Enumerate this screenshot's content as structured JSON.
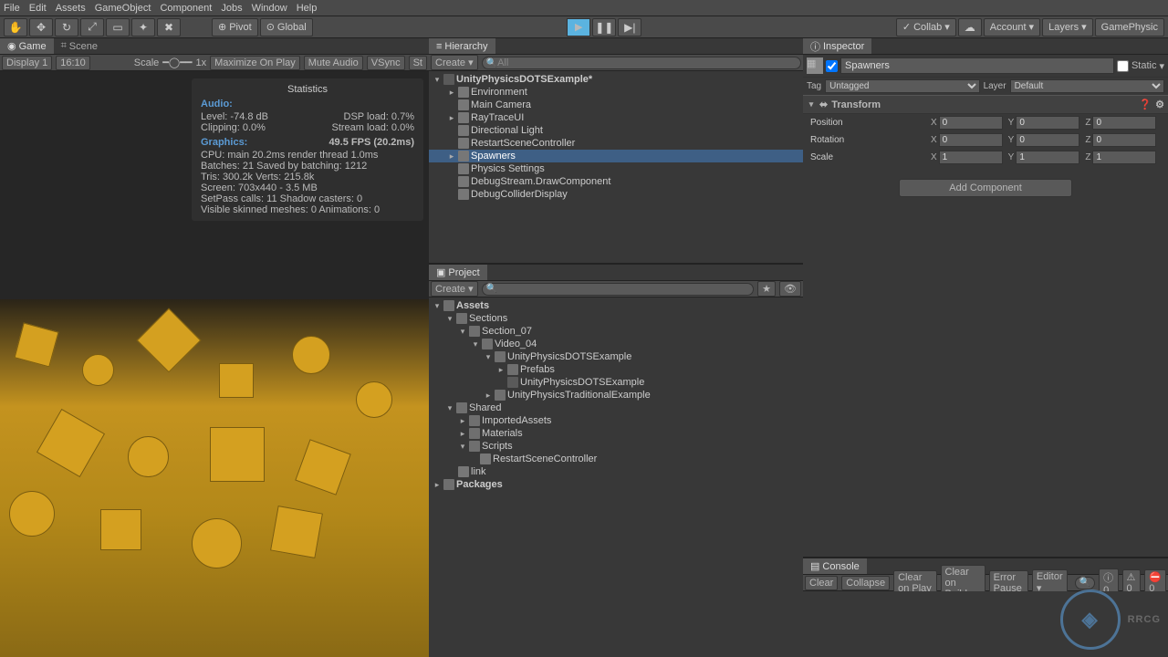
{
  "menu": [
    "File",
    "Edit",
    "Assets",
    "GameObject",
    "Component",
    "Jobs",
    "Window",
    "Help"
  ],
  "toolbar": {
    "pivot": "Pivot",
    "global": "Global",
    "collab": "Collab",
    "account": "Account",
    "layers": "Layers",
    "layout": "GamePhysic"
  },
  "gameTab": {
    "tabs": [
      "Game",
      "Scene"
    ],
    "display": "Display 1",
    "aspect": "16:10",
    "scaleLabel": "Scale",
    "scaleVal": "1x",
    "opts": [
      "Maximize On Play",
      "Mute Audio",
      "VSync",
      "St"
    ]
  },
  "stats": {
    "title": "Statistics",
    "audio": "Audio:",
    "level": "Level: -74.8 dB",
    "dsp": "DSP load: 0.7%",
    "clipping": "Clipping: 0.0%",
    "stream": "Stream load: 0.0%",
    "graphics": "Graphics:",
    "fps": "49.5 FPS (20.2ms)",
    "cpu": "CPU: main 20.2ms   render thread 1.0ms",
    "batches": "Batches: 21           Saved by batching: 1212",
    "tris": "Tris: 300.2k            Verts: 215.8k",
    "screen": "Screen: 703x440 - 3.5 MB",
    "setpass": "SetPass calls: 11      Shadow casters: 0",
    "skinned": "Visible skinned meshes: 0  Animations: 0"
  },
  "hierarchy": {
    "title": "Hierarchy",
    "create": "Create",
    "allTab": "All",
    "scene": "UnityPhysicsDOTSExample*",
    "nodes": [
      "Environment",
      "Main Camera",
      "RayTraceUI",
      "Directional Light",
      "RestartSceneController",
      "Spawners",
      "Physics Settings",
      "DebugStream.DrawComponent",
      "DebugColliderDisplay"
    ],
    "selected": 5
  },
  "project": {
    "title": "Project",
    "create": "Create",
    "tree": {
      "assets": "Assets",
      "sections": "Sections",
      "section07": "Section_07",
      "video04": "Video_04",
      "upde": "UnityPhysicsDOTSExample",
      "prefabs": "Prefabs",
      "updeScene": "UnityPhysicsDOTSExample",
      "upte": "UnityPhysicsTraditionalExample",
      "shared": "Shared",
      "imported": "ImportedAssets",
      "materials": "Materials",
      "scripts": "Scripts",
      "restart": "RestartSceneController",
      "link": "link",
      "packages": "Packages"
    }
  },
  "inspector": {
    "title": "Inspector",
    "name": "Spawners",
    "static": "Static",
    "tag": "Tag",
    "tagVal": "Untagged",
    "layer": "Layer",
    "layerVal": "Default",
    "transform": "Transform",
    "position": "Position",
    "rotation": "Rotation",
    "scale": "Scale",
    "px": "0",
    "py": "0",
    "pz": "0",
    "rx": "0",
    "ry": "0",
    "rz": "0",
    "sx": "1",
    "sy": "1",
    "sz": "1",
    "addComp": "Add Component"
  },
  "console": {
    "title": "Console",
    "clear": "Clear",
    "collapse": "Collapse",
    "clearPlay": "Clear on Play",
    "clearBuild": "Clear on Build",
    "errorPause": "Error Pause",
    "editor": "Editor"
  },
  "watermark": "RRCG"
}
